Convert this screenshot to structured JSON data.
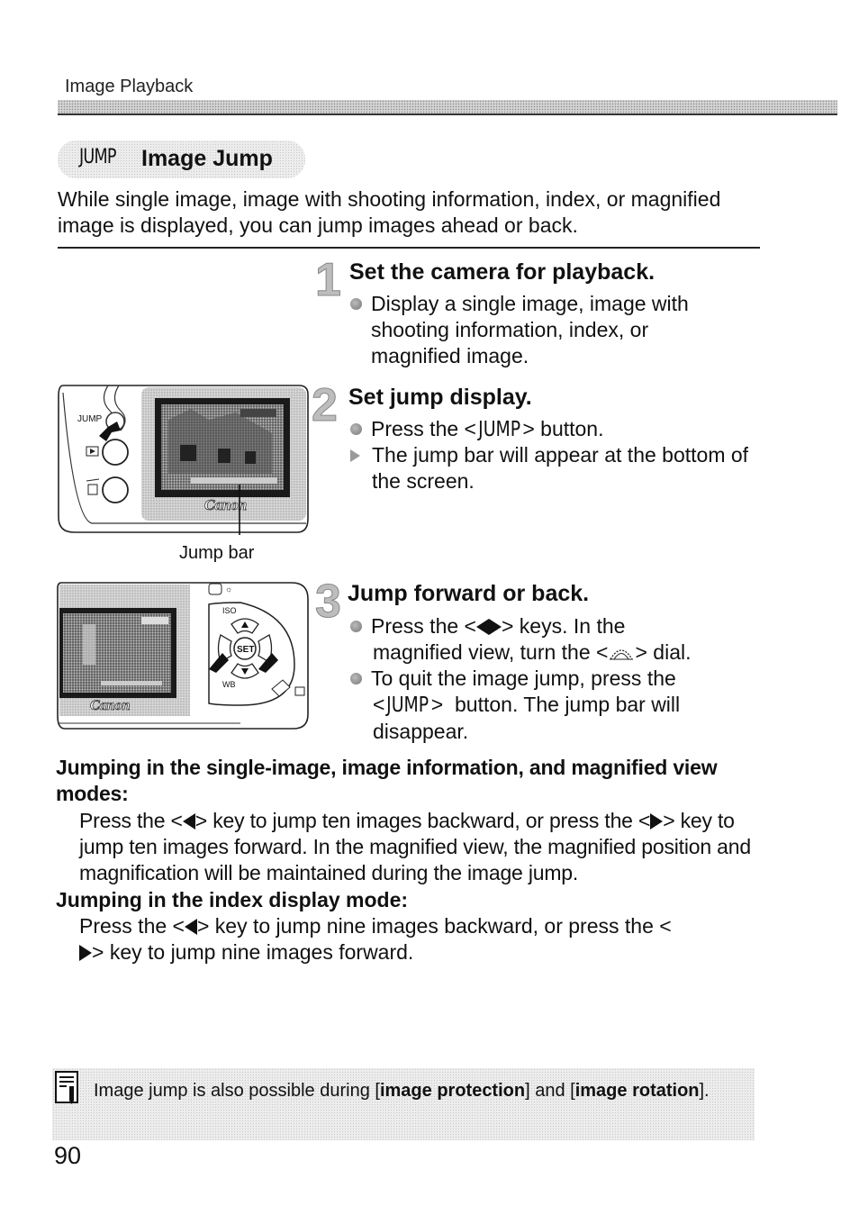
{
  "header": {
    "section_label": "Image Playback"
  },
  "title": {
    "icon_glyph": "JUMP",
    "text": "Image Jump"
  },
  "intro": "While single image, image with shooting information, index, or magnified image is displayed, you can jump images ahead or back.",
  "steps": [
    {
      "number": "1",
      "title": "Set the camera for playback.",
      "items": [
        {
          "type": "bullet",
          "text": "Display a single image, image with shooting information, index, or magnified image."
        }
      ]
    },
    {
      "number": "2",
      "title": "Set jump display.",
      "items": [
        {
          "type": "bullet",
          "prefix": "Press the <",
          "key": "JUMP",
          "suffix": "> button."
        },
        {
          "type": "result",
          "text": "The jump bar will appear at the bottom of the screen."
        }
      ]
    },
    {
      "number": "3",
      "title": "Jump forward or back.",
      "items": [
        {
          "type": "bullet",
          "prefix": "Press the <",
          "suffix": "> keys. In the magnified view, turn the <",
          "suffix2": "> dial."
        },
        {
          "type": "bullet",
          "prefix": "To quit the image jump, press the <",
          "key": "JUMP",
          "suffix": "> button. The jump bar will disappear."
        }
      ]
    }
  ],
  "figures": {
    "fig1": {
      "button_label": "JUMP",
      "brand": "Canon",
      "callout": "Jump bar"
    },
    "fig2": {
      "brand": "Canon",
      "iso_label": "ISO",
      "wb_label": "WB",
      "set_label": "SET"
    }
  },
  "subsections": [
    {
      "title": "Jumping in the single-image, image information, and magnified view modes:",
      "body_parts": [
        "Press the <",
        "> key to jump ten images backward, or press the <",
        "> key to jump ten images forward. In the magnified view, the magnified position and magnification will be maintained during the image jump."
      ]
    },
    {
      "title": "Jumping in the index display mode:",
      "body_parts": [
        "Press the <",
        "> key to jump nine images backward, or press the <",
        "> key to jump nine images forward."
      ]
    }
  ],
  "note": {
    "icon": "memo-pencil-icon",
    "text_before": "Image jump is also possible during [",
    "bold1": "image protection",
    "text_mid": "] and [",
    "bold2": "image rotation",
    "text_after": "]."
  },
  "page_number": "90"
}
